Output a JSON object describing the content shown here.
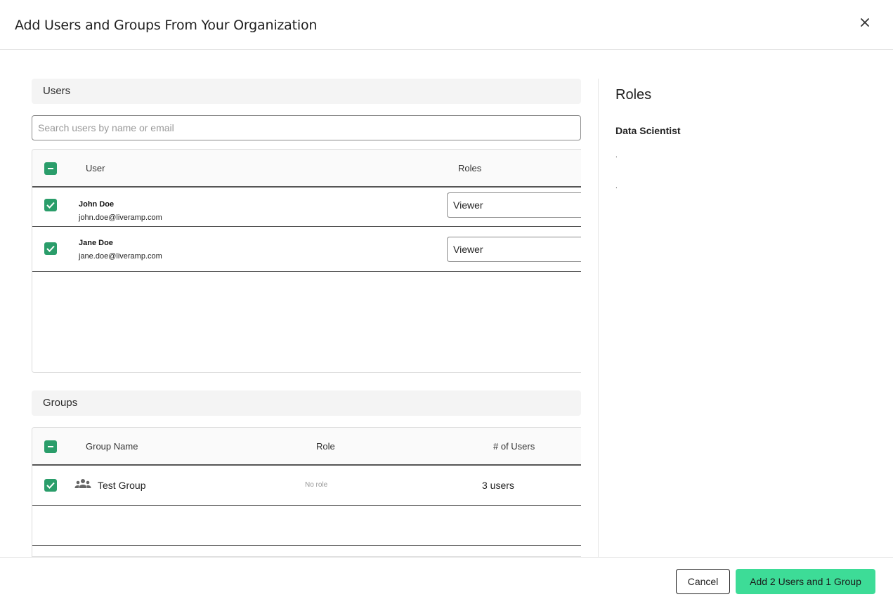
{
  "modal": {
    "title": "Add Users and Groups From Your Organization"
  },
  "users_section": {
    "title": "Users",
    "search_placeholder": "Search users by name or email",
    "columns": {
      "user": "User",
      "roles": "Roles"
    },
    "rows": [
      {
        "name": "John Doe",
        "email": "john.doe@liveramp.com",
        "role": "Viewer",
        "checked": true
      },
      {
        "name": "Jane Doe",
        "email": "jane.doe@liveramp.com",
        "role": "Viewer",
        "checked": true
      }
    ]
  },
  "groups_section": {
    "title": "Groups",
    "columns": {
      "name": "Group Name",
      "role": "Role",
      "users": "# of Users"
    },
    "rows": [
      {
        "name": "Test Group",
        "role": "No role",
        "users": "3 users",
        "checked": true
      }
    ]
  },
  "roles_panel": {
    "title": "Roles",
    "role_name": "Data Scientist",
    "bullets": [
      ".",
      "."
    ]
  },
  "footer": {
    "cancel_label": "Cancel",
    "primary_label": "Add 2 Users and 1 Group"
  },
  "colors": {
    "checkbox": "#2a9d6a",
    "primary_button": "#3ddc97"
  },
  "icons": {
    "close": "close-icon",
    "group": "group-icon",
    "check": "check-icon",
    "indeterminate": "minus-icon"
  }
}
